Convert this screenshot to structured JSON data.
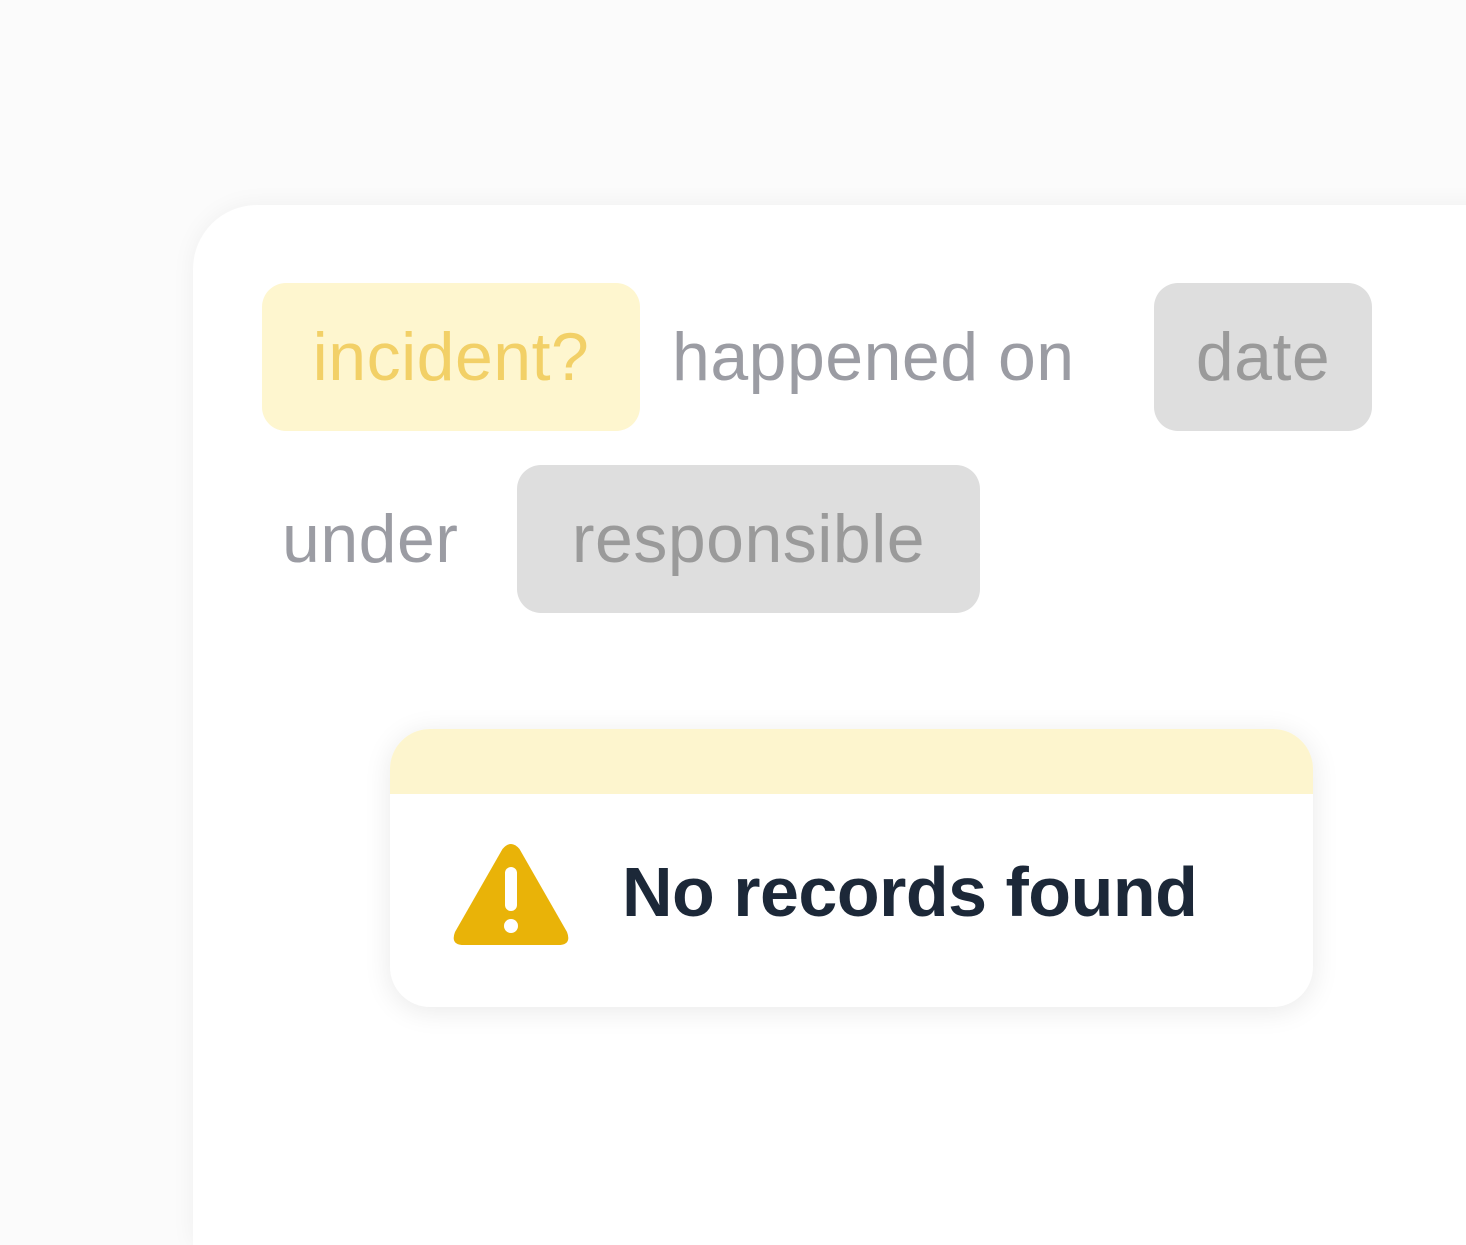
{
  "query": {
    "subject_chip": "incident?",
    "connector_1": "happened on",
    "date_chip": "date",
    "connector_2": "under",
    "responsible_chip": "responsible"
  },
  "result": {
    "icon": "warning-triangle-icon",
    "message": "No records found"
  },
  "colors": {
    "highlight_chip_bg": "#fef6cf",
    "highlight_chip_text": "#f2d067",
    "neutral_chip_bg": "#dedede",
    "neutral_chip_text": "#9a9a9a",
    "connector_text": "#9b9ca3",
    "popup_bar": "#fdf5ce",
    "warning": "#e9b308",
    "message_text": "#1c2838"
  }
}
